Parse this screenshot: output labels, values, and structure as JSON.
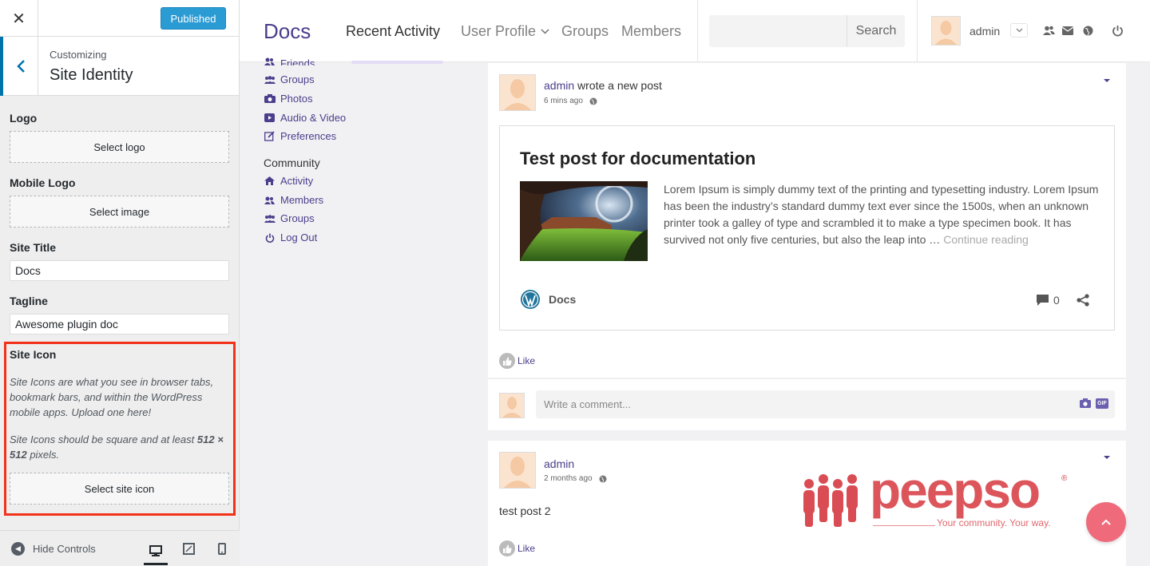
{
  "customizer": {
    "close_icon": "close-icon",
    "publish_label": "Published",
    "breadcrumb": "Customizing",
    "section_title": "Site Identity",
    "logo": {
      "label": "Logo",
      "button": "Select logo"
    },
    "mobile_logo": {
      "label": "Mobile Logo",
      "button": "Select image"
    },
    "site_title": {
      "label": "Site Title",
      "value": "Docs"
    },
    "tagline": {
      "label": "Tagline",
      "value": "Awesome plugin doc"
    },
    "site_icon": {
      "label": "Site Icon",
      "desc1": "Site Icons are what you see in browser tabs, bookmark bars, and within the WordPress mobile apps. Upload one here!",
      "desc2_pre": "Site Icons should be square and at least ",
      "desc2_size": "512 × 512",
      "desc2_post": " pixels.",
      "button": "Select site icon",
      "highlight_color": "#f2311a"
    },
    "footer": {
      "hide_controls": "Hide Controls"
    }
  },
  "header": {
    "logo": "Docs",
    "nav": [
      "Recent Activity",
      "User Profile",
      "Groups",
      "Members"
    ],
    "search_button": "Search",
    "search_placeholder": "",
    "username": "admin"
  },
  "left_menu": {
    "profile_items": [
      "Friends",
      "Groups",
      "Photos",
      "Audio & Video",
      "Preferences"
    ],
    "community_heading": "Community",
    "community_items": [
      "Activity",
      "Members",
      "Groups",
      "Log Out"
    ]
  },
  "posts": [
    {
      "author": "admin",
      "action": " wrote a new post",
      "time": "6 mins ago",
      "embed": {
        "title": "Test post for documentation",
        "excerpt": "Lorem Ipsum is simply dummy text of the printing and typesetting industry. Lorem Ipsum has been the industry’s standard dummy text ever since the 1500s, when an unknown printer took a galley of type and scrambled it to make a type specimen book. It has survived not only five centuries, but also the leap into … ",
        "more": "Continue reading",
        "site": "Docs",
        "comment_count": "0"
      },
      "like": "Like",
      "comment_placeholder": "Write a comment..."
    },
    {
      "author": "admin",
      "time": "2 months ago",
      "text": "test post 2",
      "like": "Like"
    }
  ],
  "watermark": {
    "brand": "peepso",
    "tagline": "Your community. Your way."
  },
  "colors": {
    "accent": "#4a3f8c",
    "publish": "#2b9bd4",
    "fab": "#ef6b7c",
    "brand_red": "#d9434a"
  }
}
